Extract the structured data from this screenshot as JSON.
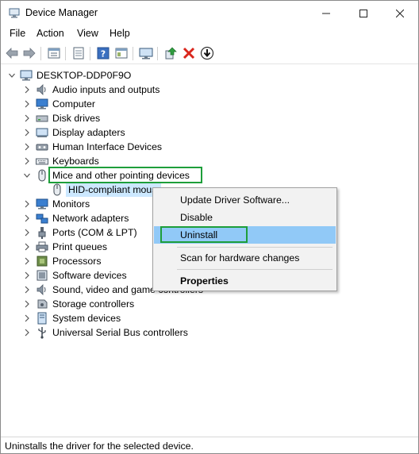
{
  "window": {
    "title": "Device Manager"
  },
  "menu": {
    "file": "File",
    "action": "Action",
    "view": "View",
    "help": "Help"
  },
  "toolbar_icons": [
    "back-icon",
    "forward-icon",
    "device-list-icon",
    "properties-icon",
    "help-icon",
    "properties-sheet-icon",
    "monitor-scan-icon",
    "update-driver-icon",
    "uninstall-icon",
    "download-icon"
  ],
  "tree": {
    "root": "DESKTOP-DDP0F9O",
    "items": [
      {
        "label": "Audio inputs and outputs",
        "expanded": false
      },
      {
        "label": "Computer",
        "expanded": false
      },
      {
        "label": "Disk drives",
        "expanded": false
      },
      {
        "label": "Display adapters",
        "expanded": false
      },
      {
        "label": "Human Interface Devices",
        "expanded": false
      },
      {
        "label": "Keyboards",
        "expanded": false
      },
      {
        "label": "Mice and other pointing devices",
        "expanded": true
      },
      {
        "label": "HID-compliant mouse",
        "child": true
      },
      {
        "label": "Monitors",
        "expanded": false
      },
      {
        "label": "Network adapters",
        "expanded": false
      },
      {
        "label": "Ports (COM & LPT)",
        "expanded": false
      },
      {
        "label": "Print queues",
        "expanded": false
      },
      {
        "label": "Processors",
        "expanded": false
      },
      {
        "label": "Software devices",
        "expanded": false
      },
      {
        "label": "Sound, video and game controllers",
        "expanded": false
      },
      {
        "label": "Storage controllers",
        "expanded": false
      },
      {
        "label": "System devices",
        "expanded": false
      },
      {
        "label": "Universal Serial Bus controllers",
        "expanded": false
      }
    ]
  },
  "context_menu": {
    "update": "Update Driver Software...",
    "disable": "Disable",
    "uninstall": "Uninstall",
    "scan": "Scan for hardware changes",
    "properties": "Properties"
  },
  "status": {
    "text": "Uninstalls the driver for the selected device."
  },
  "colors": {
    "selection": "#cce8ff",
    "hover": "#91c9f7",
    "highlight_box": "#1e9e3a",
    "uninstall_red": "#d9261c"
  }
}
